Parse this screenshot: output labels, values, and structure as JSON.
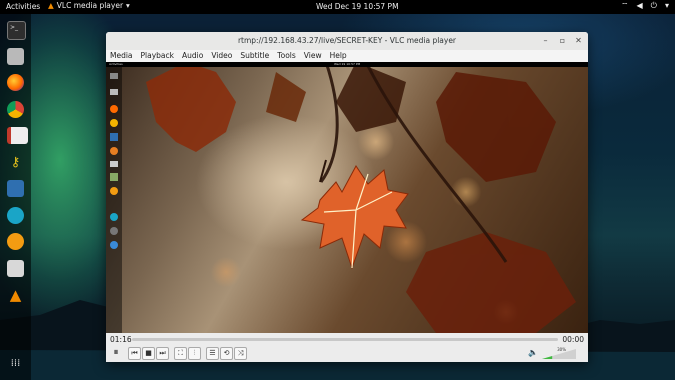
{
  "topbar": {
    "activities": "Activities",
    "app_name": "VLC media player",
    "clock": "Wed Dec 19  10:57 PM"
  },
  "dock": {
    "items": [
      "terminal-icon",
      "files-icon",
      "firefox-icon",
      "chrome-icon",
      "document-viewer-icon",
      "keyring-icon",
      "text-editor-icon",
      "network-icon",
      "screencast-icon",
      "software-store-icon",
      "vlc-icon",
      "app-grid-icon"
    ]
  },
  "vlc": {
    "title": "rtmp://192.168.43.27/live/SECRET-KEY - VLC media player",
    "menus": [
      "Media",
      "Playback",
      "Audio",
      "Video",
      "Subtitle",
      "Tools",
      "View",
      "Help"
    ],
    "time_elapsed": "01:16",
    "time_total": "00:00",
    "volume_percent": "30%",
    "volume_level": 0.3,
    "inner": {
      "activities": "Activities",
      "clock": "Wed 19  10:57 PM"
    }
  },
  "colors": {
    "accent_green": "#3fb93f",
    "vlc_orange": "#f08a00"
  }
}
